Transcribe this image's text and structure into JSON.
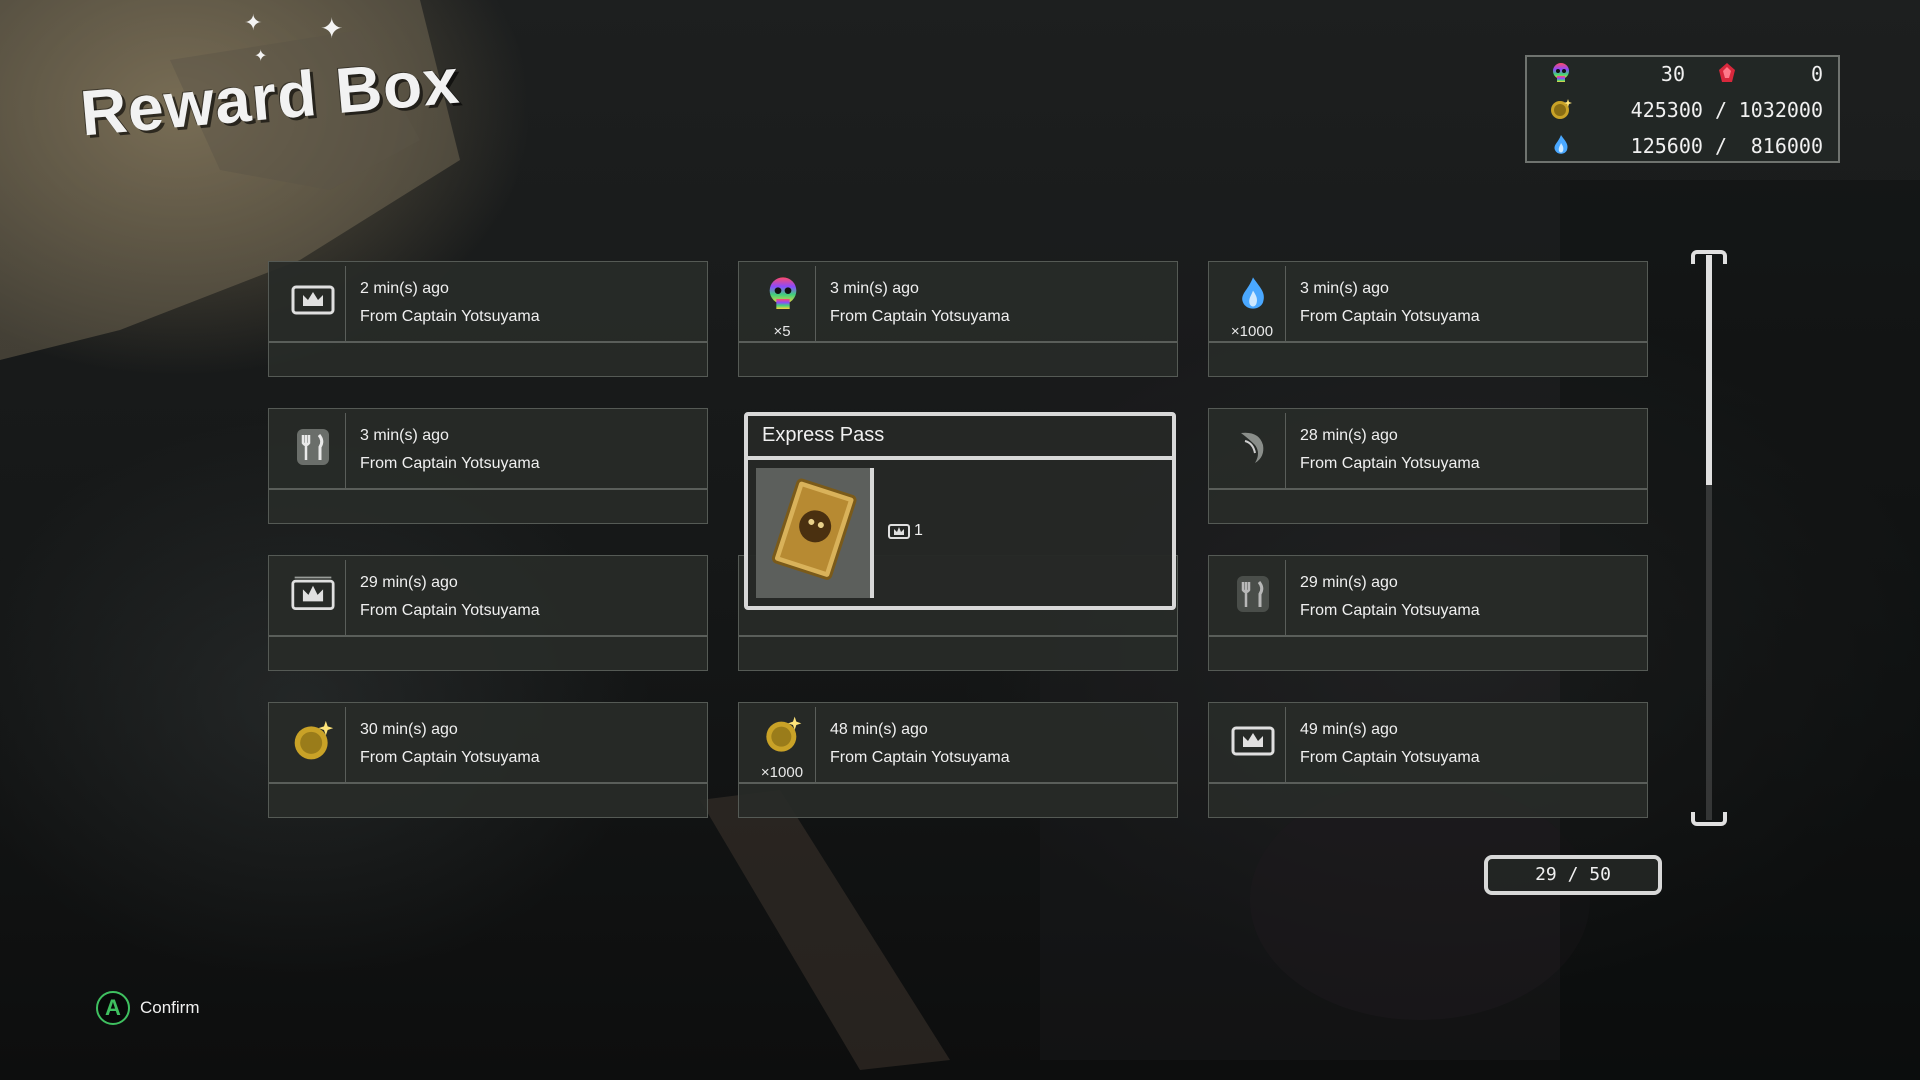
{
  "screen": {
    "title": "Reward Box"
  },
  "resources": {
    "skull_count": "30",
    "red_count": "0",
    "gold": "425300 /",
    "gold_max": "1032000",
    "souls": "125600 /",
    "souls_max": "816000"
  },
  "rewards": [
    {
      "time": "2 min(s) ago",
      "from": "From Captain Yotsuyama",
      "icon": "crown-ticket-icon",
      "qty": ""
    },
    {
      "time": "3 min(s) ago",
      "from": "From Captain Yotsuyama",
      "icon": "rainbow-skull-icon",
      "qty": "×5"
    },
    {
      "time": "3 min(s) ago",
      "from": "From Captain Yotsuyama",
      "icon": "blue-flame-icon",
      "qty": "×1000"
    },
    {
      "time": "3 min(s) ago",
      "from": "From Captain Yotsuyama",
      "icon": "fork-knife-icon",
      "qty": ""
    },
    {
      "time": "",
      "from": "",
      "icon": "",
      "qty": ""
    },
    {
      "time": "28 min(s) ago",
      "from": "From Captain Yotsuyama",
      "icon": "claw-icon",
      "qty": ""
    },
    {
      "time": "29 min(s) ago",
      "from": "From Captain Yotsuyama",
      "icon": "crown-ticket-icon",
      "qty": ""
    },
    {
      "time": "",
      "from": "",
      "icon": "",
      "qty": ""
    },
    {
      "time": "29 min(s) ago",
      "from": "From Captain Yotsuyama",
      "icon": "fork-knife-icon",
      "qty": ""
    },
    {
      "time": "30 min(s) ago",
      "from": "From Captain Yotsuyama",
      "icon": "gold-coin-icon",
      "qty": ""
    },
    {
      "time": "48 min(s) ago",
      "from": "From Captain Yotsuyama",
      "icon": "gold-coin-icon",
      "qty": "×1000"
    },
    {
      "time": "49 min(s) ago",
      "from": "From Captain Yotsuyama",
      "icon": "crown-ticket-icon",
      "qty": ""
    }
  ],
  "popup": {
    "title": "Express Pass",
    "qty": "1"
  },
  "pager": {
    "text": "29 / 50"
  },
  "controls": {
    "confirm_button": "A",
    "confirm_label": "Confirm"
  },
  "colors": {
    "accent_green": "#3fc060",
    "card_bg": "#282b28",
    "gold": "#c9a227",
    "soul_blue": "#4aa8ff"
  }
}
